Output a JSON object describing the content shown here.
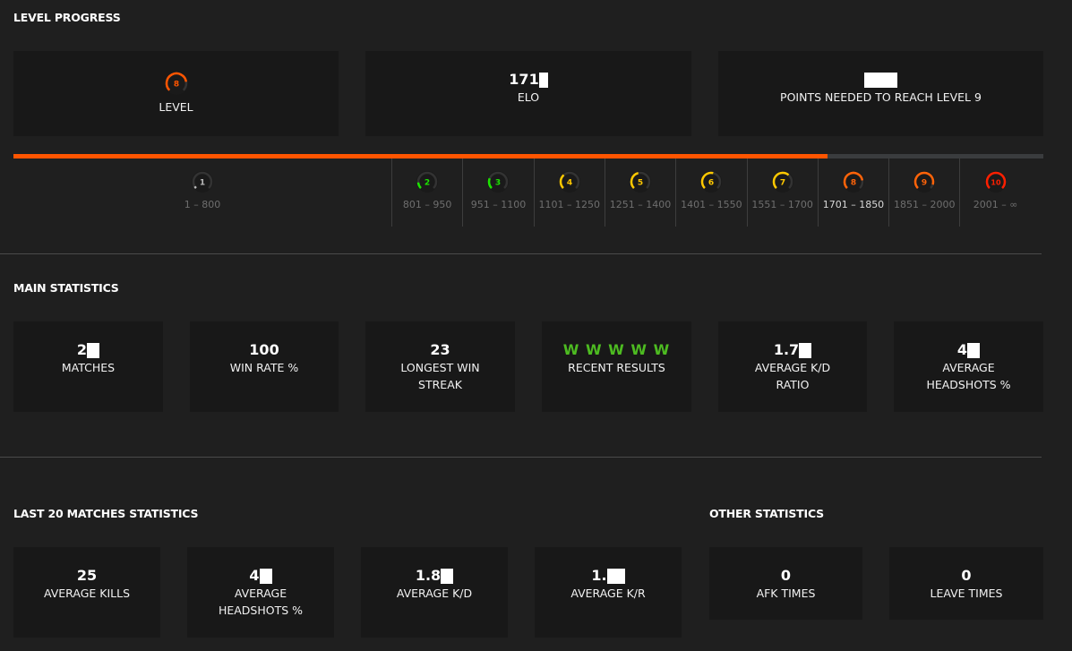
{
  "level_progress": {
    "title": "LEVEL PROGRESS",
    "level_card": {
      "level": "8",
      "label": "LEVEL",
      "color": "#ff5500"
    },
    "elo_card": {
      "value_visible": "171",
      "label": "ELO"
    },
    "points_card": {
      "label": "POINTS NEEDED TO REACH LEVEL 9"
    },
    "progress_fraction": 0.79,
    "levels": [
      {
        "level": "1",
        "range": "1 – 800",
        "color": "#bbbbbb",
        "arc": 0.05
      },
      {
        "level": "2",
        "range": "801 – 950",
        "color": "#1ce400",
        "arc": 0.15
      },
      {
        "level": "3",
        "range": "951 – 1100",
        "color": "#1ce400",
        "arc": 0.25
      },
      {
        "level": "4",
        "range": "1101 – 1250",
        "color": "#ffc800",
        "arc": 0.35
      },
      {
        "level": "5",
        "range": "1251 – 1400",
        "color": "#ffc800",
        "arc": 0.45
      },
      {
        "level": "6",
        "range": "1401 – 1550",
        "color": "#ffc800",
        "arc": 0.55
      },
      {
        "level": "7",
        "range": "1551 – 1700",
        "color": "#ffc800",
        "arc": 0.65
      },
      {
        "level": "8",
        "range": "1701 – 1850",
        "color": "#ff6309",
        "arc": 0.8,
        "current": true
      },
      {
        "level": "9",
        "range": "1851 – 2000",
        "color": "#ff6309",
        "arc": 0.9
      },
      {
        "level": "10",
        "range": "2001 – ∞",
        "color": "#fe1f00",
        "arc": 1.0
      }
    ]
  },
  "main_statistics": {
    "title": "MAIN STATISTICS",
    "cards": [
      {
        "value": "2",
        "redacted": true,
        "label": "MATCHES"
      },
      {
        "value": "100",
        "label": "WIN RATE %"
      },
      {
        "value": "23",
        "label": "LONGEST WIN STREAK"
      },
      {
        "value": "W W W W W",
        "label": "RECENT RESULTS",
        "color": "#4dbb21"
      },
      {
        "value": "1.7",
        "redacted": true,
        "label": "AVERAGE K/D RATIO"
      },
      {
        "value": "4",
        "redacted": true,
        "label": "AVERAGE HEADSHOTS %"
      }
    ]
  },
  "last20": {
    "title": "LAST 20 MATCHES STATISTICS",
    "cards": [
      {
        "value": "25",
        "label": "AVERAGE KILLS"
      },
      {
        "value": "4",
        "redacted": true,
        "label": "AVERAGE HEADSHOTS %"
      },
      {
        "value": "1.8",
        "redacted": true,
        "label": "AVERAGE K/D"
      },
      {
        "value": "1.",
        "redacted": true,
        "label": "AVERAGE K/R"
      }
    ]
  },
  "other_statistics": {
    "title": "OTHER STATISTICS",
    "cards": [
      {
        "value": "0",
        "label": "AFK TIMES"
      },
      {
        "value": "0",
        "label": "LEAVE TIMES"
      }
    ]
  }
}
